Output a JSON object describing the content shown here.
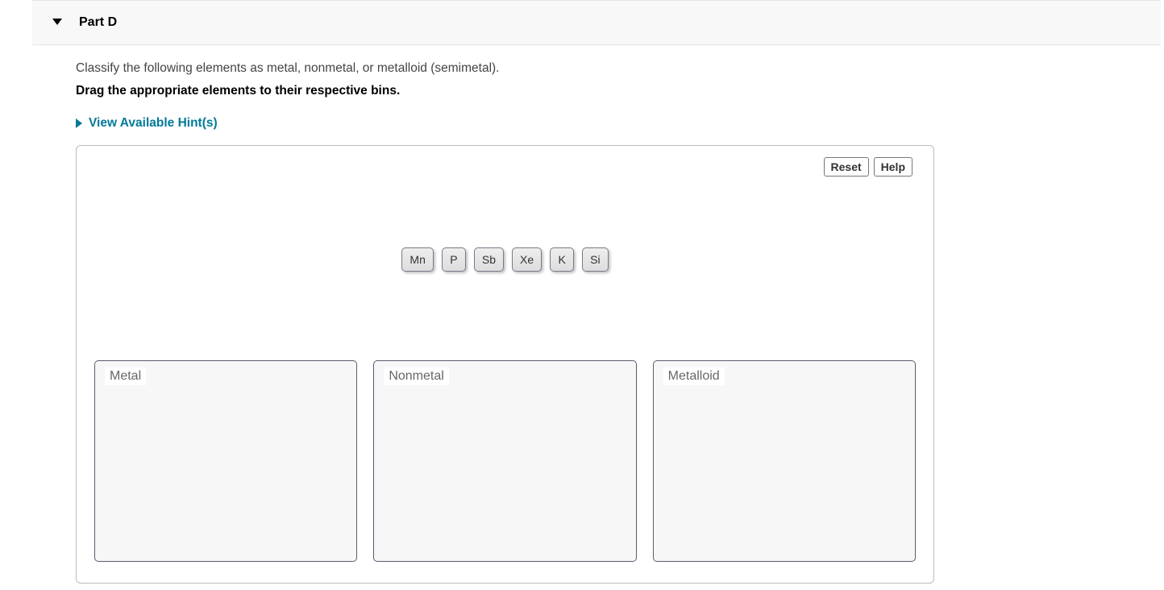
{
  "part": {
    "title": "Part D"
  },
  "question": "Classify the following elements as metal, nonmetal, or metalloid (semimetal).",
  "instruction": "Drag the appropriate elements to their respective bins.",
  "hints": {
    "label": "View Available Hint(s)"
  },
  "buttons": {
    "reset": "Reset",
    "help": "Help"
  },
  "chips": [
    "Mn",
    "P",
    "Sb",
    "Xe",
    "K",
    "Si"
  ],
  "bins": [
    {
      "label": "Metal"
    },
    {
      "label": "Nonmetal"
    },
    {
      "label": "Metalloid"
    }
  ]
}
